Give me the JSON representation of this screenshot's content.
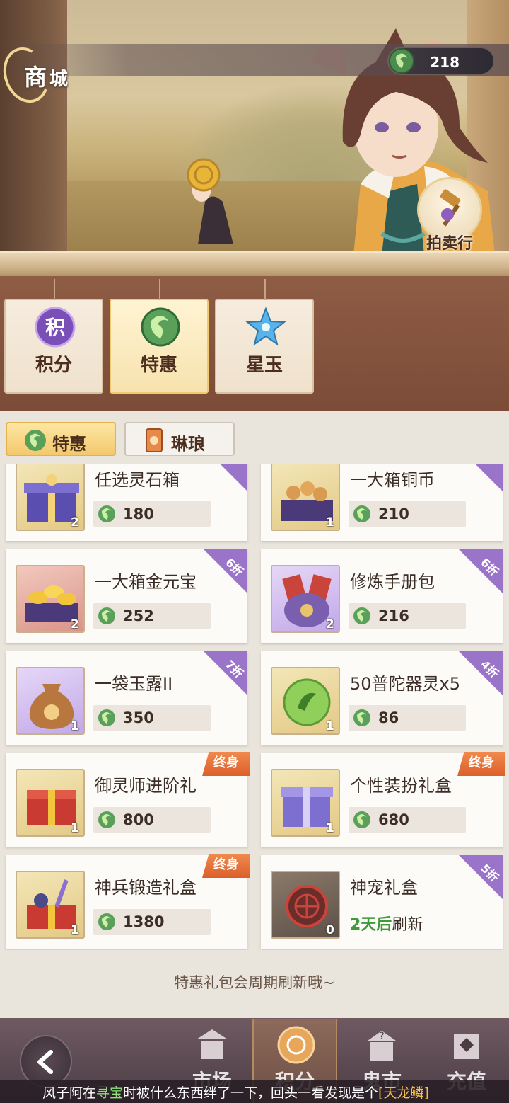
{
  "header": {
    "title_big": "商",
    "title_small": "城",
    "currency_amount": "218",
    "auction_label": "拍卖行"
  },
  "categories": [
    {
      "label": "积分",
      "icon_char": "积",
      "icon": "points-icon",
      "active": false
    },
    {
      "label": "特惠",
      "icon": "jade-coin-icon",
      "active": true
    },
    {
      "label": "星玉",
      "icon": "star-jade-icon",
      "active": false
    }
  ],
  "subtabs": [
    {
      "label": "特惠",
      "active": true
    },
    {
      "label": "琳琅",
      "active": false
    }
  ],
  "items": [
    {
      "name": "任选灵石箱",
      "price": "180",
      "qty": "2",
      "tag": "",
      "thumb": "gold"
    },
    {
      "name": "一大箱铜币",
      "price": "210",
      "qty": "1",
      "tag": "",
      "thumb": "gold"
    },
    {
      "name": "一大箱金元宝",
      "price": "252",
      "qty": "2",
      "tag": "6折",
      "thumb": "red"
    },
    {
      "name": "修炼手册包",
      "price": "216",
      "qty": "2",
      "tag": "6折",
      "thumb": "purple"
    },
    {
      "name": "一袋玉露II",
      "price": "350",
      "qty": "1",
      "tag": "7折",
      "thumb": "purple"
    },
    {
      "name": "50普陀器灵x5",
      "price": "86",
      "qty": "1",
      "tag": "4折",
      "thumb": "gold"
    },
    {
      "name": "御灵师进阶礼",
      "price": "800",
      "qty": "1",
      "tag": "终身",
      "thumb": "gold"
    },
    {
      "name": "个性装扮礼盒",
      "price": "680",
      "qty": "1",
      "tag": "终身",
      "thumb": "gold"
    },
    {
      "name": "神兵锻造礼盒",
      "price": "1380",
      "qty": "1",
      "tag": "终身",
      "thumb": "gold"
    },
    {
      "name": "神宠礼盒",
      "refresh_highlight": "2天后",
      "refresh_rest": "刷新",
      "qty": "0",
      "tag": "5折",
      "thumb": "dark"
    }
  ],
  "footer_note": "特惠礼包会周期刷新哦~",
  "bottom_nav": [
    {
      "label": "市场",
      "icon": "market-icon",
      "active": false
    },
    {
      "label": "积分",
      "icon": "points-coin-icon",
      "active": true
    },
    {
      "label": "鬼市",
      "icon": "ghost-market-icon",
      "active": false
    },
    {
      "label": "充值",
      "icon": "recharge-icon",
      "active": false
    }
  ],
  "ticker": {
    "part1": "风子阿在",
    "part2": "寻宝",
    "part3": "时被什么东西绊了一下，回头一看发现是个",
    "part4": "[天龙鳞]"
  },
  "colors": {
    "accent_gold": "#f3c96e",
    "discount_purple": "#9a74c8",
    "lifetime_orange": "#e0672f",
    "refresh_green": "#3f9a3a"
  }
}
